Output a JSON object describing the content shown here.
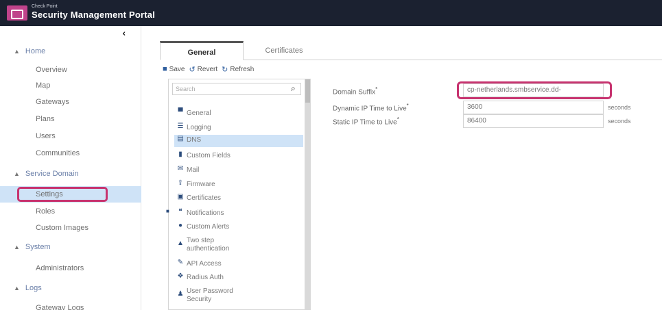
{
  "header": {
    "brand_small": "Check Point",
    "brand_title": "Security Management Portal"
  },
  "sidebar": {
    "collapse_glyph": "‹",
    "sections": [
      {
        "label": "Home",
        "items": [
          "Overview",
          "Map",
          "Gateways",
          "Plans",
          "Users",
          "Communities"
        ]
      },
      {
        "label": "Service Domain",
        "items": [
          "Settings",
          "Roles",
          "Custom Images"
        ]
      },
      {
        "label": "System",
        "items": [
          "Administrators"
        ]
      },
      {
        "label": "Logs",
        "items": [
          "Gateway Logs"
        ]
      }
    ],
    "active_item": "Settings"
  },
  "tabs": {
    "general": "General",
    "certificates": "Certificates"
  },
  "toolbar": {
    "save": "Save",
    "revert": "Revert",
    "refresh": "Refresh"
  },
  "settings_list": {
    "search_placeholder": "Search",
    "items": [
      {
        "label": "General",
        "icon": "monitor-icon"
      },
      {
        "label": "Logging",
        "icon": "list-icon"
      },
      {
        "label": "DNS",
        "icon": "server-icon"
      },
      {
        "label": "Custom Fields",
        "icon": "bookmark-icon"
      },
      {
        "label": "Mail",
        "icon": "mail-icon"
      },
      {
        "label": "Firmware",
        "icon": "upload-icon"
      },
      {
        "label": "Certificates",
        "icon": "certificate-icon"
      },
      {
        "label": "Notifications",
        "icon": "notification-icon"
      },
      {
        "label": "Custom Alerts",
        "icon": "alert-icon"
      },
      {
        "label": "Two step authentication",
        "icon": "lock-icon"
      },
      {
        "label": "API Access",
        "icon": "pencil-icon"
      },
      {
        "label": "Radius Auth",
        "icon": "radius-icon"
      },
      {
        "label": "User Password Security",
        "icon": "user-lock-icon"
      }
    ],
    "active_item": "DNS"
  },
  "form": {
    "domain_suffix": {
      "label": "Domain Suffix",
      "required_mark": "*",
      "value": "cp-netherlands.smbservice.dd-"
    },
    "dynamic_ttl": {
      "label": "Dynamic IP Time to Live",
      "required_mark": "*",
      "value": "3600",
      "unit": "seconds"
    },
    "static_ttl": {
      "label": "Static IP Time to Live",
      "required_mark": "*",
      "value": "86400",
      "unit": "seconds"
    }
  },
  "colors": {
    "topbar": "#1b2130",
    "logo": "#c0438b",
    "highlight": "#c7336f",
    "active_bg": "#cfe3f7"
  }
}
